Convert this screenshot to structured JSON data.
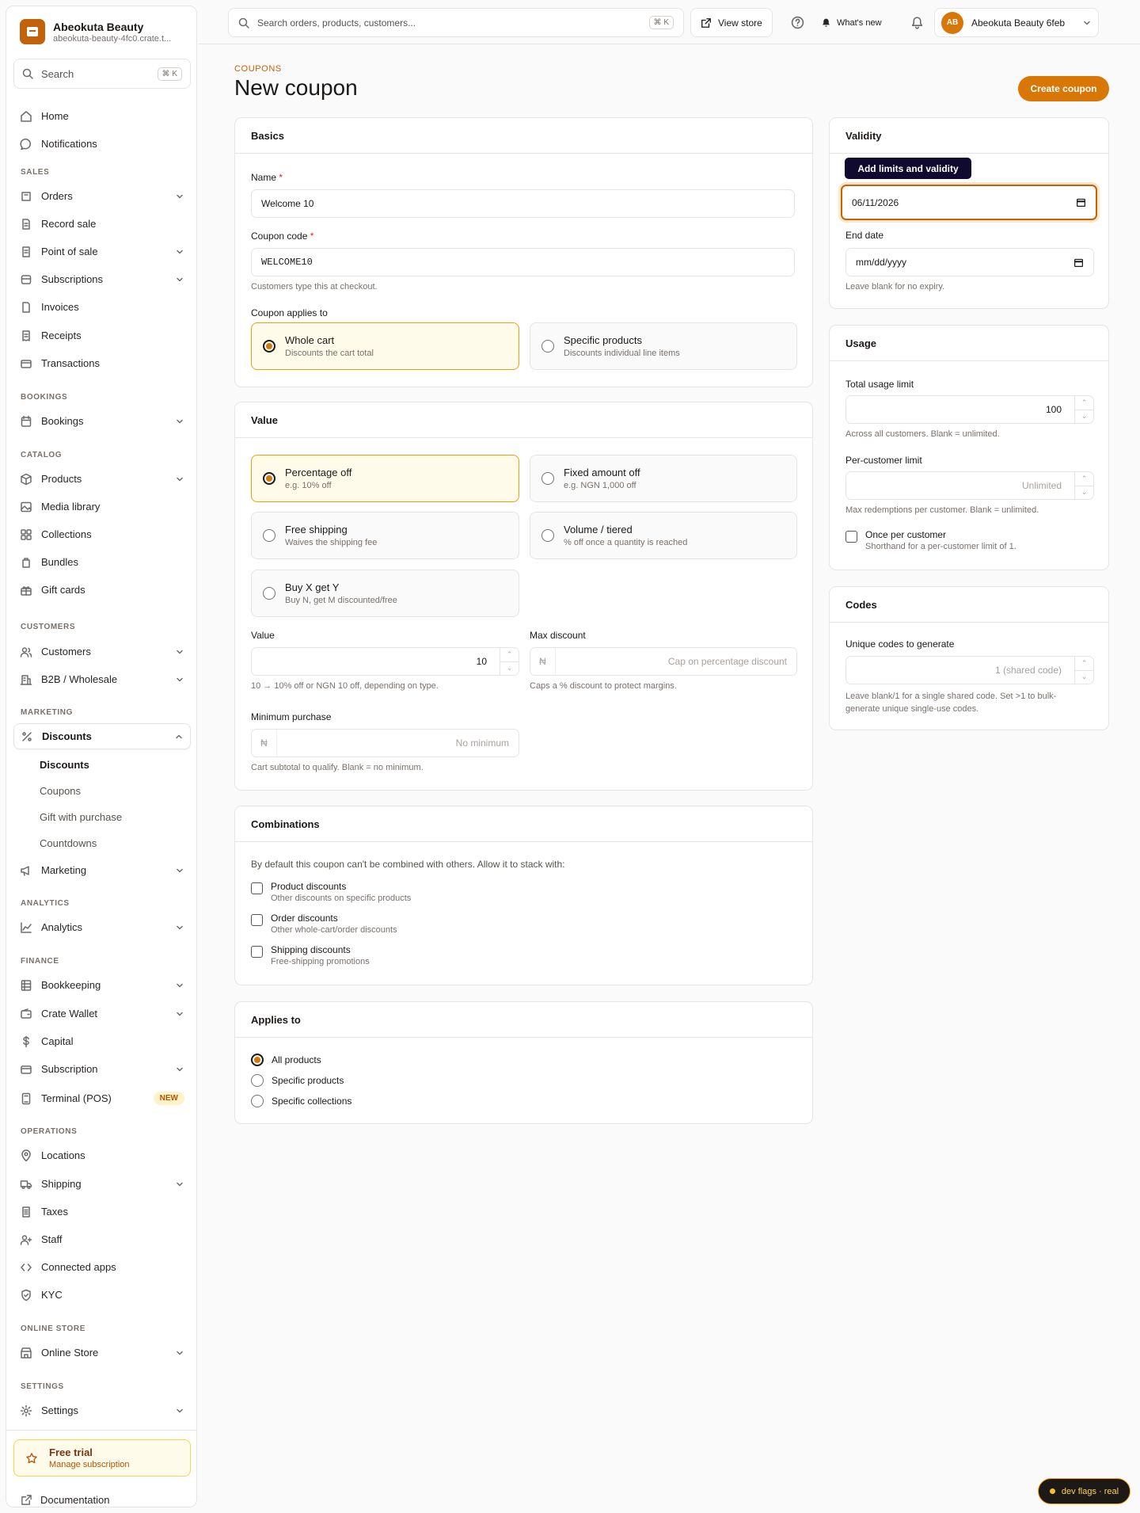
{
  "brand": {
    "name": "Abeokuta Beauty",
    "url": "abeokuta-beauty-4fc0.crate.t..."
  },
  "sidebar": {
    "search": {
      "placeholder": "Search",
      "shortcut": "⌘ K"
    },
    "home": "Home",
    "notifications": "Notifications",
    "sections": {
      "sales": "SALES",
      "bookings": "BOOKINGS",
      "catalog": "CATALOG",
      "customers": "CUSTOMERS",
      "marketing": "MARKETING",
      "analytics": "ANALYTICS",
      "finance": "FINANCE",
      "operations": "OPERATIONS",
      "online_store": "ONLINE STORE",
      "settings": "SETTINGS"
    },
    "items": {
      "orders": "Orders",
      "record_sale": "Record sale",
      "pos": "Point of sale",
      "subscriptions": "Subscriptions",
      "invoices": "Invoices",
      "receipts": "Receipts",
      "transactions": "Transactions",
      "bookings": "Bookings",
      "products": "Products",
      "media": "Media library",
      "collections": "Collections",
      "bundles": "Bundles",
      "gift_cards": "Gift cards",
      "customers": "Customers",
      "b2b": "B2B / Wholesale",
      "discounts": "Discounts",
      "marketing": "Marketing",
      "analytics": "Analytics",
      "bookkeeping": "Bookkeeping",
      "wallet": "Crate Wallet",
      "capital": "Capital",
      "subscription": "Subscription",
      "terminal": "Terminal (POS)",
      "locations": "Locations",
      "shipping": "Shipping",
      "taxes": "Taxes",
      "staff": "Staff",
      "apps": "Connected apps",
      "kyc": "KYC",
      "online_store": "Online Store",
      "settings": "Settings"
    },
    "discounts_sub": [
      "Discounts",
      "Coupons",
      "Gift with purchase",
      "Countdowns"
    ],
    "new_badge": "NEW",
    "trial": {
      "title": "Free trial",
      "sub": "Manage subscription"
    },
    "docs": "Documentation"
  },
  "topbar": {
    "search_placeholder": "Search orders, products, customers...",
    "shortcut": "⌘ K",
    "view_store": "View store",
    "whats_new": "What's new",
    "avatar": "AB",
    "store": "Abeokuta Beauty 6feb"
  },
  "page": {
    "crumb": "COUPONS",
    "title": "New coupon",
    "create": "Create coupon"
  },
  "basics": {
    "title": "Basics",
    "name_label": "Name",
    "name_value": "Welcome 10",
    "code_label": "Coupon code",
    "code_value": "WELCOME10",
    "code_help": "Customers type this at checkout.",
    "applies_label": "Coupon applies to",
    "whole": {
      "t": "Whole cart",
      "d": "Discounts the cart total"
    },
    "specific": {
      "t": "Specific products",
      "d": "Discounts individual line items"
    }
  },
  "value": {
    "title": "Value",
    "types": [
      {
        "t": "Percentage off",
        "d": "e.g. 10% off"
      },
      {
        "t": "Fixed amount off",
        "d": "e.g. NGN 1,000 off"
      },
      {
        "t": "Free shipping",
        "d": "Waives the shipping fee"
      },
      {
        "t": "Volume / tiered",
        "d": "% off once a quantity is reached"
      },
      {
        "t": "Buy X get Y",
        "d": "Buy N, get M discounted/free"
      }
    ],
    "value_label": "Value",
    "value_value": "10",
    "value_help": "10 → 10% off or NGN 10 off, depending on type.",
    "max_label": "Max discount",
    "currency": "₦",
    "max_placeholder": "Cap on percentage discount",
    "max_help": "Caps a % discount to protect margins.",
    "min_label": "Minimum purchase",
    "min_placeholder": "No minimum",
    "min_help": "Cart subtotal to qualify. Blank = no minimum."
  },
  "combinations": {
    "title": "Combinations",
    "intro": "By default this coupon can't be combined with others. Allow it to stack with:",
    "items": [
      {
        "t": "Product discounts",
        "d": "Other discounts on specific products"
      },
      {
        "t": "Order discounts",
        "d": "Other whole-cart/order discounts"
      },
      {
        "t": "Shipping discounts",
        "d": "Free-shipping promotions"
      }
    ]
  },
  "applies": {
    "title": "Applies to",
    "options": [
      "All products",
      "Specific products",
      "Specific collections"
    ]
  },
  "validity": {
    "title": "Validity",
    "tooltip": "Add limits and validity",
    "start_value": "06/11/2026",
    "end_label": "End date",
    "end_placeholder": "mm/dd/yyyy",
    "end_help": "Leave blank for no expiry."
  },
  "usage": {
    "title": "Usage",
    "total_label": "Total usage limit",
    "total_value": "100",
    "total_help": "Across all customers. Blank = unlimited.",
    "per_label": "Per-customer limit",
    "per_placeholder": "Unlimited",
    "per_help": "Max redemptions per customer. Blank = unlimited.",
    "once_t": "Once per customer",
    "once_d": "Shorthand for a per-customer limit of 1."
  },
  "codes": {
    "title": "Codes",
    "label": "Unique codes to generate",
    "placeholder": "1 (shared code)",
    "help": "Leave blank/1 for a single shared code. Set >1 to bulk-generate unique single-use codes."
  },
  "devflag": "dev flags · real"
}
